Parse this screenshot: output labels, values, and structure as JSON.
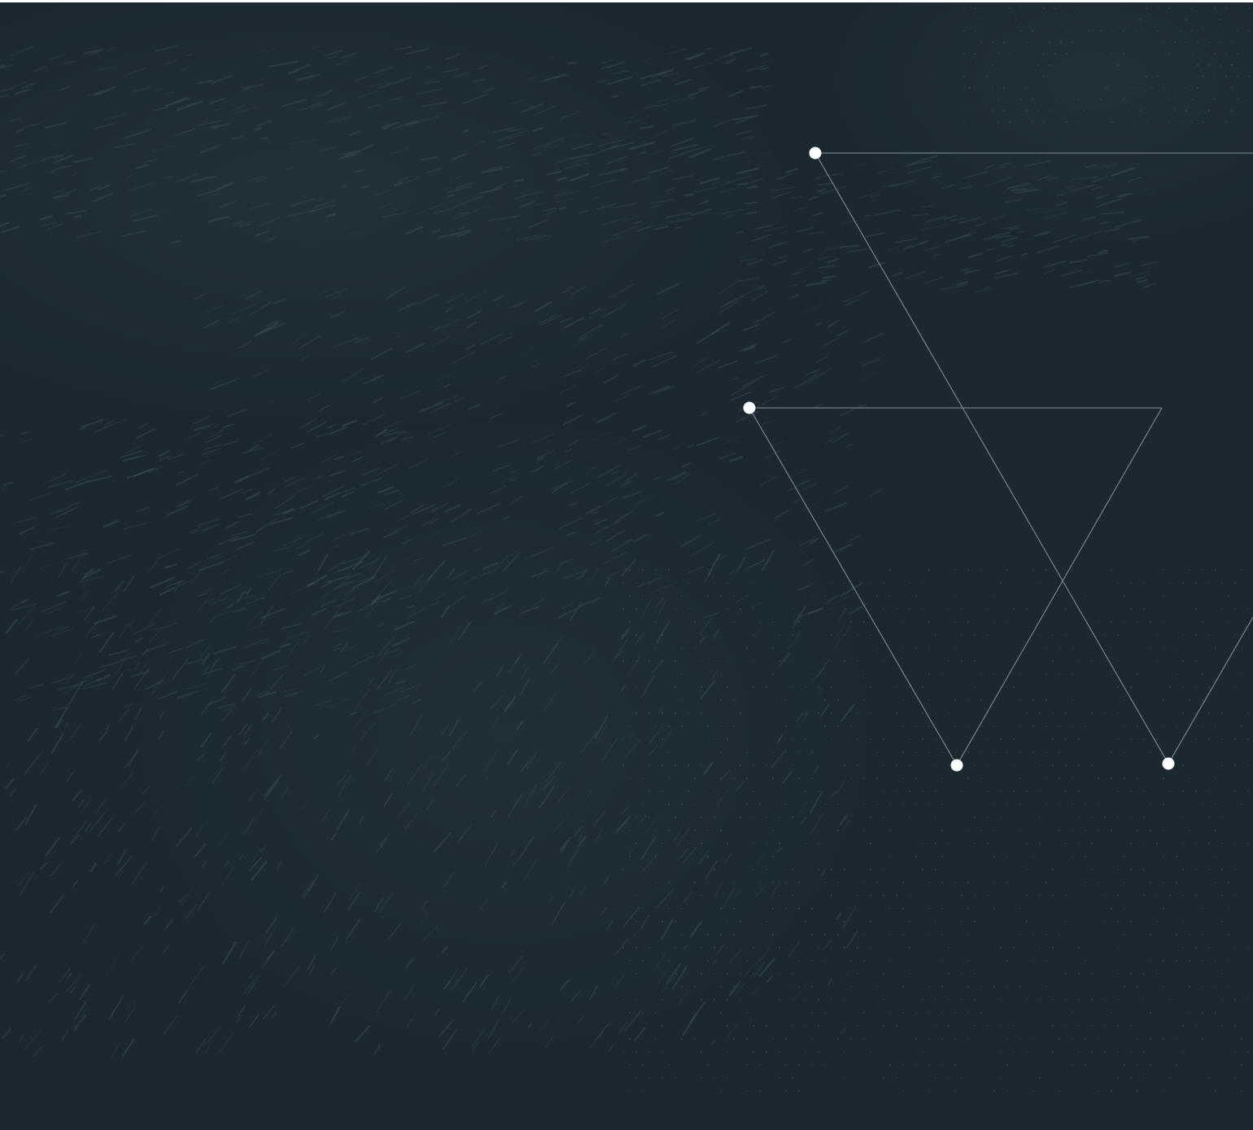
{
  "background": {
    "base_color": "#1b2830",
    "texture_color": "#3e505a",
    "dot_color": "#41535d"
  },
  "graphic": {
    "line_color": "#6f7d84",
    "node_color": "#ffffff"
  }
}
